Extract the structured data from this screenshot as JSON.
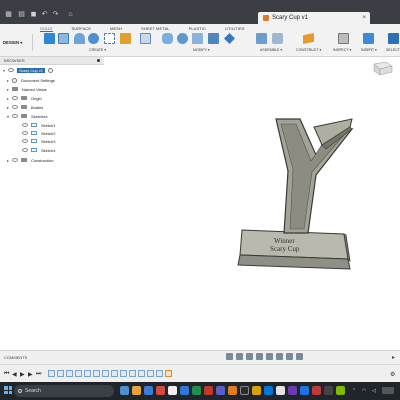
{
  "window": {
    "title": "Scary Cup v1"
  },
  "ribbon": {
    "tabs": [
      "SOLID",
      "SURFACE",
      "MESH",
      "SHEET METAL",
      "PLASTIC",
      "UTILITIES"
    ],
    "active_tab": "SOLID",
    "workspace": "DESIGN",
    "groups": [
      "CREATE",
      "MODIFY",
      "ASSEMBLE",
      "CONSTRUCT",
      "INSPECT",
      "INSERT",
      "SELECT"
    ]
  },
  "browser": {
    "title": "BROWSER",
    "items": [
      {
        "label": "Scary Cup v1",
        "type": "root",
        "selected": true
      },
      {
        "label": "Document Settings",
        "type": "gear"
      },
      {
        "label": "Named Views",
        "type": "folder"
      },
      {
        "label": "Origin",
        "type": "folder"
      },
      {
        "label": "Bodies",
        "type": "folder"
      },
      {
        "label": "Sketches",
        "type": "folder"
      },
      {
        "label": "Sketch1",
        "type": "sketch"
      },
      {
        "label": "Sketch2",
        "type": "sketch"
      },
      {
        "label": "Sketch3",
        "type": "sketch"
      },
      {
        "label": "Sketch4",
        "type": "sketch"
      },
      {
        "label": "Construction",
        "type": "folder"
      }
    ]
  },
  "model": {
    "engraving_line1": "Winner",
    "engraving_line2": "Scary Cup"
  },
  "comments": {
    "title": "COMMENTS"
  },
  "taskbar": {
    "search_placeholder": "Search"
  },
  "colors": {
    "ribbon_bg": "#f2f2f2",
    "active_tab": "#1f72c6",
    "titlebar": "#3b3f45",
    "taskbar": "#20242b",
    "model_face": "#9f9f93",
    "model_edge": "#3a3a36",
    "selection": "#2b6cb0"
  }
}
